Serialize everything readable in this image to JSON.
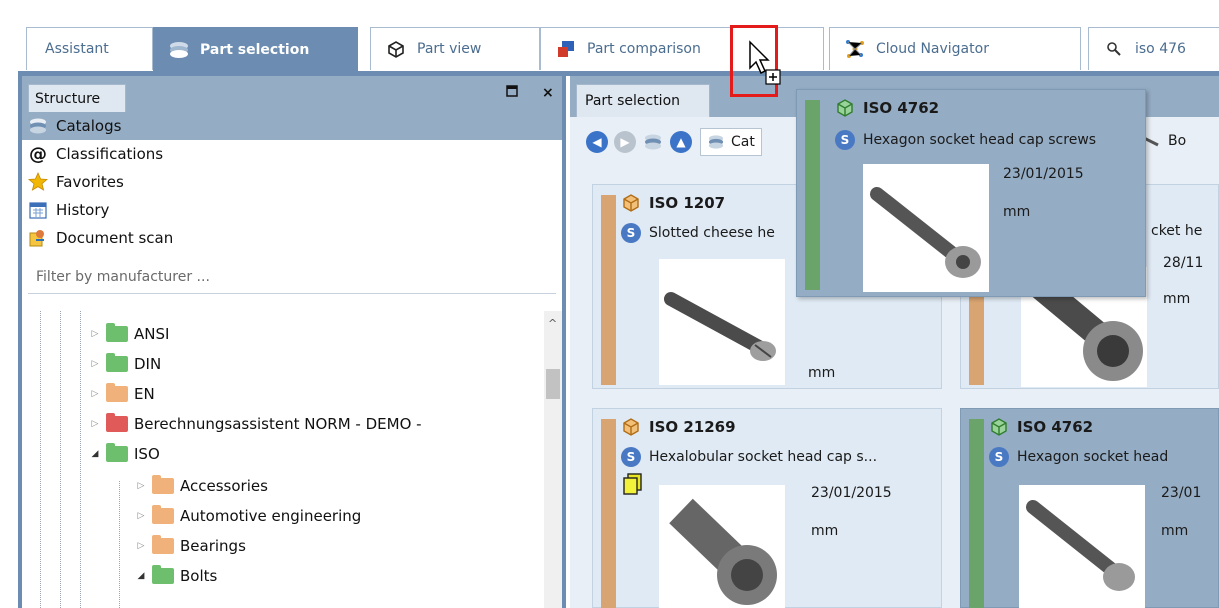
{
  "tabs": [
    {
      "label": "Assistant",
      "icon": "none"
    },
    {
      "label": "Part selection",
      "icon": "catalog-icon"
    },
    {
      "label": "Part view",
      "icon": "part-view-icon"
    },
    {
      "label": "Part comparison",
      "icon": "comparison-icon"
    },
    {
      "label": "Cloud Navigator",
      "icon": "cloud-icon"
    },
    {
      "label": "iso 476",
      "icon": "search-icon"
    }
  ],
  "left": {
    "tab": "Structure",
    "nav": [
      {
        "label": "Catalogs"
      },
      {
        "label": "Classifications"
      },
      {
        "label": "Favorites"
      },
      {
        "label": "History"
      },
      {
        "label": "Document scan"
      }
    ],
    "filter_placeholder": "Filter by manufacturer ...",
    "tree": [
      {
        "label": "ANSI"
      },
      {
        "label": "DIN"
      },
      {
        "label": "EN"
      },
      {
        "label": "Berechnungsassistent NORM - DEMO -"
      },
      {
        "label": "ISO"
      },
      {
        "label": "Accessories"
      },
      {
        "label": "Automotive engineering"
      },
      {
        "label": "Bearings"
      },
      {
        "label": "Bolts"
      }
    ]
  },
  "right": {
    "tab": "Part selection",
    "crumb1": "Cat",
    "crumb2": "Bo",
    "cards": [
      {
        "title": "ISO 1207",
        "desc": "Slotted cheese he",
        "date": "",
        "unit": "mm"
      },
      {
        "title": "",
        "desc": "cket he",
        "date": "28/11",
        "unit": "mm"
      },
      {
        "title": "ISO 21269",
        "desc": "Hexalobular socket head cap s...",
        "date": "23/01/2015",
        "unit": "mm"
      },
      {
        "title": "ISO 4762",
        "desc": "Hexagon socket head",
        "date": "23/01",
        "unit": "mm"
      }
    ]
  },
  "tooltip": {
    "title": "ISO 4762",
    "desc": "Hexagon socket head cap screws",
    "date": "23/01/2015",
    "unit": "mm"
  },
  "colors": {
    "accent": "#6c8db1",
    "highlight": "#94acc4",
    "tan_bar": "#d8a472",
    "green_bar": "#6aa46a"
  }
}
